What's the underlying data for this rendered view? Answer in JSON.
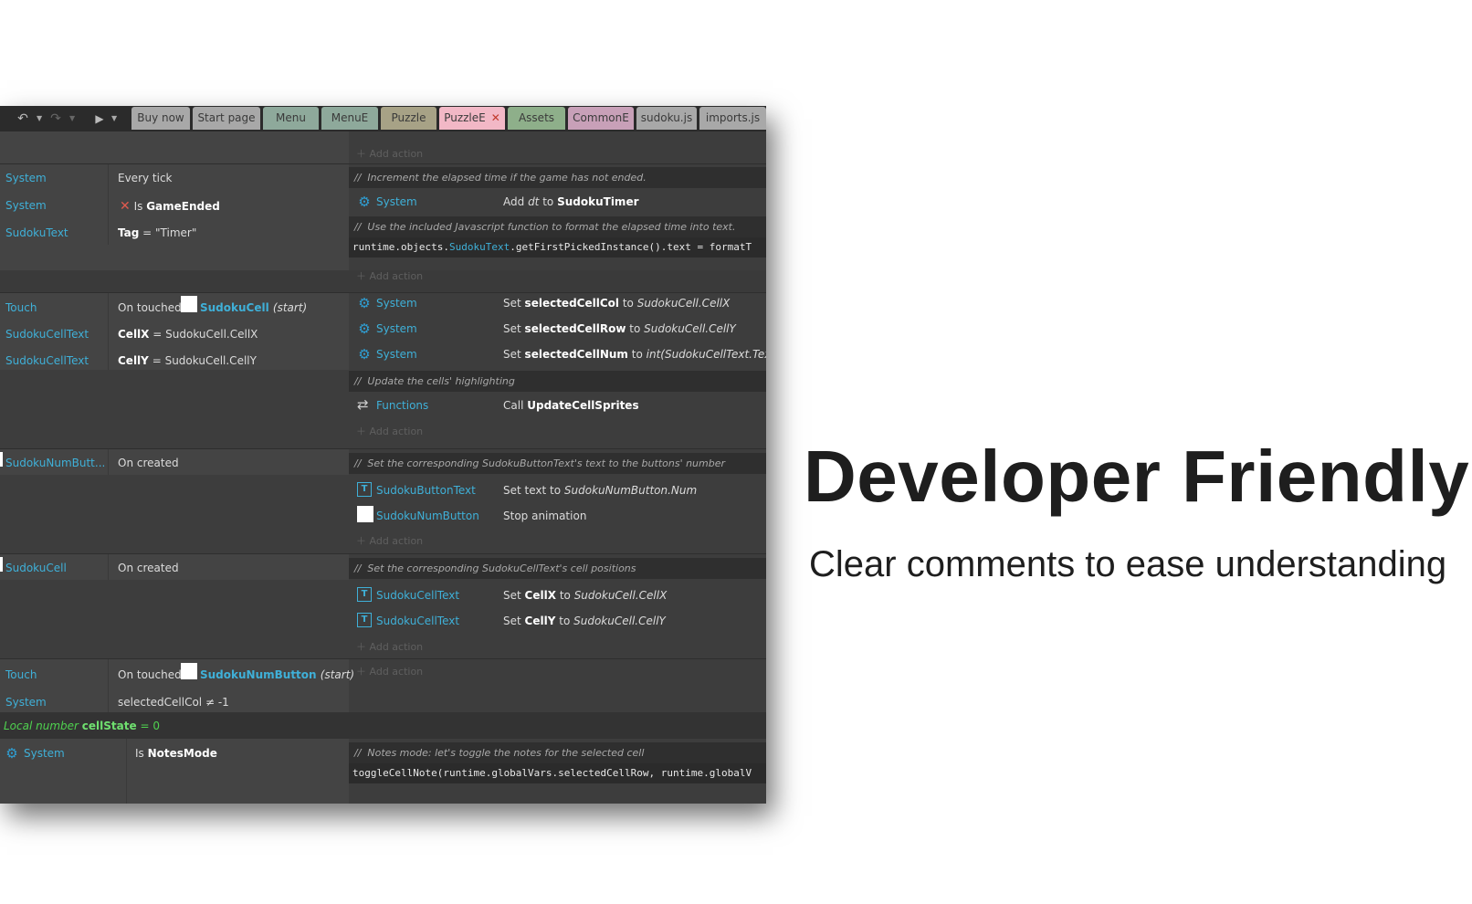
{
  "toolbar": {
    "tabs": [
      {
        "label": "Buy now",
        "color": "#a8a8a8"
      },
      {
        "label": "Start page",
        "color": "#a8a8a8"
      },
      {
        "label": "Menu",
        "color": "#8ea99b"
      },
      {
        "label": "MenuE",
        "color": "#8ea99b"
      },
      {
        "label": "Puzzle",
        "color": "#a7a286"
      },
      {
        "label": "PuzzleE",
        "color": "#f2b8c6"
      },
      {
        "label": "Assets",
        "color": "#8eaf8a"
      },
      {
        "label": "CommonE",
        "color": "#c8a0b8"
      },
      {
        "label": "sudoku.js",
        "color": "#a8a8a8"
      },
      {
        "label": "imports.js",
        "color": "#a8a8a8"
      }
    ]
  },
  "events": {
    "add_action": "Add action",
    "ev1": {
      "conds": [
        {
          "obj": "System",
          "text": "Every tick"
        },
        {
          "obj": "System",
          "text": "Is",
          "bold": "GameEnded"
        },
        {
          "obj": "SudokuText",
          "key": "Tag",
          "rest": "= \"Timer\""
        }
      ],
      "comment1": "Increment the elapsed time if the game has not ended.",
      "action1": {
        "obj": "System",
        "pre": "Add",
        "it": "dt",
        "mid": "to",
        "bold": "SudokuTimer"
      },
      "comment2": "Use the included Javascript function to format the elapsed time into text.",
      "code": {
        "pre": "runtime.objects.",
        "obj": "SudokuText",
        "post": ".getFirstPickedInstance().text = formatT"
      }
    },
    "ev2": {
      "conds": [
        {
          "obj": "Touch",
          "pre": "On touched",
          "bold": "SudokuCell",
          "it": "(start)"
        },
        {
          "obj": "SudokuCellText",
          "key": "CellX",
          "rest": "= SudokuCell.CellX"
        },
        {
          "obj": "SudokuCellText",
          "key": "CellY",
          "rest": "= SudokuCell.CellY"
        }
      ],
      "actions": [
        {
          "obj": "System",
          "pre": "Set",
          "bold": "selectedCellCol",
          "mid": "to",
          "it": "SudokuCell.CellX"
        },
        {
          "obj": "System",
          "pre": "Set",
          "bold": "selectedCellRow",
          "mid": "to",
          "it": "SudokuCell.CellY"
        },
        {
          "obj": "System",
          "pre": "Set",
          "bold": "selectedCellNum",
          "mid": "to",
          "it": "int(SudokuCellText.Text)"
        }
      ],
      "comment": "Update the cells' highlighting",
      "fn": {
        "obj": "Functions",
        "pre": "Call",
        "bold": "UpdateCellSprites"
      }
    },
    "ev3": {
      "cond": {
        "obj": "SudokuNumButt...",
        "text": "On created"
      },
      "comment": "Set the corresponding SudokuButtonText's text to the buttons' number",
      "actions": [
        {
          "obj": "SudokuButtonText",
          "pre": "Set text to",
          "it": "SudokuNumButton.Num"
        },
        {
          "obj": "SudokuNumButton",
          "pre": "Stop animation"
        }
      ]
    },
    "ev4": {
      "cond": {
        "obj": "SudokuCell",
        "text": "On created"
      },
      "comment": "Set the corresponding SudokuCellText's cell positions",
      "actions": [
        {
          "obj": "SudokuCellText",
          "pre": "Set",
          "bold": "CellX",
          "mid": "to",
          "it": "SudokuCell.CellX"
        },
        {
          "obj": "SudokuCellText",
          "pre": "Set",
          "bold": "CellY",
          "mid": "to",
          "it": "SudokuCell.CellY"
        }
      ]
    },
    "ev5": {
      "conds": [
        {
          "obj": "Touch",
          "pre": "On touched",
          "bold": "SudokuNumButton",
          "it": "(start)"
        },
        {
          "obj": "System",
          "text": "selectedCellCol ≠ -1"
        }
      ],
      "local": {
        "pre": "Local number",
        "bold": "cellState",
        "rest": "= 0"
      },
      "sub": {
        "obj": "System",
        "pre": "Is",
        "bold": "NotesMode"
      },
      "comment": "Notes mode: let's toggle the notes for the selected cell",
      "code": "toggleCellNote(runtime.globalVars.selectedCellRow, runtime.globalV"
    }
  },
  "promo": {
    "headline": "Developer Friendly",
    "subline": "Clear comments to ease understanding"
  }
}
